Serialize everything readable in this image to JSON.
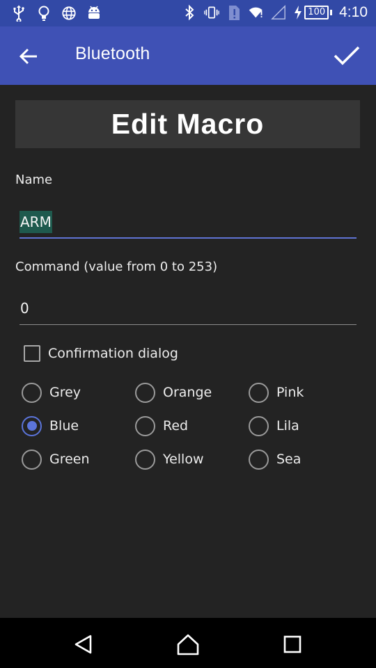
{
  "status_bar": {
    "left_icons": [
      "usb-icon",
      "lightbulb-icon",
      "globe-icon",
      "android-icon"
    ],
    "right_icons": [
      "bluetooth-icon",
      "vibrate-icon",
      "sim-alert-icon",
      "wifi-icon",
      "signal-icon",
      "charging-icon"
    ],
    "battery_level": "100",
    "time": "4:10",
    "color": "#3249a6"
  },
  "toolbar": {
    "title": "Bluetooth",
    "back_icon": "arrow-back-icon",
    "done_icon": "check-icon",
    "color": "#3f51b5"
  },
  "main": {
    "heading": "Edit Macro",
    "name_label": "Name",
    "name_value": "ARM",
    "command_label": "Command (value from 0 to 253)",
    "command_value": "0",
    "confirmation_label": "Confirmation dialog",
    "confirmation_checked": false,
    "colors": [
      {
        "label": "Grey",
        "checked": false
      },
      {
        "label": "Orange",
        "checked": false
      },
      {
        "label": "Pink",
        "checked": false
      },
      {
        "label": "Blue",
        "checked": true
      },
      {
        "label": "Red",
        "checked": false
      },
      {
        "label": "Lila",
        "checked": false
      },
      {
        "label": "Green",
        "checked": false
      },
      {
        "label": "Yellow",
        "checked": false
      },
      {
        "label": "Sea",
        "checked": false
      }
    ],
    "accent_color": "#5b74da"
  },
  "nav_bar": {
    "buttons": [
      "back-triangle-icon",
      "home-icon",
      "recents-icon"
    ]
  }
}
